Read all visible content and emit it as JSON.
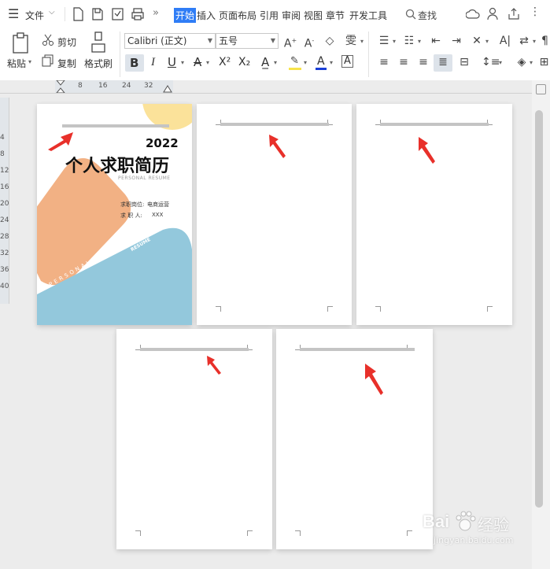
{
  "menubar": {
    "file_label": "文件",
    "tabs": [
      "开始",
      "插入",
      "页面布局",
      "引用",
      "审阅",
      "视图",
      "章节",
      "开发工具"
    ],
    "active_tab": "开始",
    "search_label": "查找"
  },
  "ribbon": {
    "paste_label": "粘贴",
    "cut_label": "剪切",
    "copy_label": "复制",
    "format_painter_label": "格式刷",
    "font_name": "Calibri (正文)",
    "font_size": "五号",
    "bold_label": "B",
    "italic_label": "I",
    "underline_label": "U",
    "strike_label": "A",
    "superscript_label": "X²",
    "subscript_label": "X₂",
    "font_color": "#1a3fd8",
    "highlight_color": "#f7e34a"
  },
  "ruler": {
    "h_ticks": [
      "8",
      "16",
      "24",
      "32"
    ],
    "v_ticks": [
      "4",
      "8",
      "12",
      "16",
      "20",
      "24",
      "28",
      "32",
      "36",
      "40"
    ]
  },
  "resume": {
    "year": "2022",
    "title": "个人求职简历",
    "subtitle": "PERSONAL RESUME",
    "position_label": "求职岗位:",
    "position_value": "电商运营",
    "name_label": "求 职 人:",
    "name_value": "XXX",
    "band_word_1": "PERSONAL",
    "band_word_2": "RESUME"
  },
  "colors": {
    "arrow": "#e8302a",
    "orange_shape": "#f2b184",
    "yellow_shape": "#fbe29a",
    "blue_shape": "#93c8dc"
  },
  "watermark": {
    "brand": "Bai",
    "brand_suffix": "经验",
    "url": "jingyan.baidu.com"
  }
}
